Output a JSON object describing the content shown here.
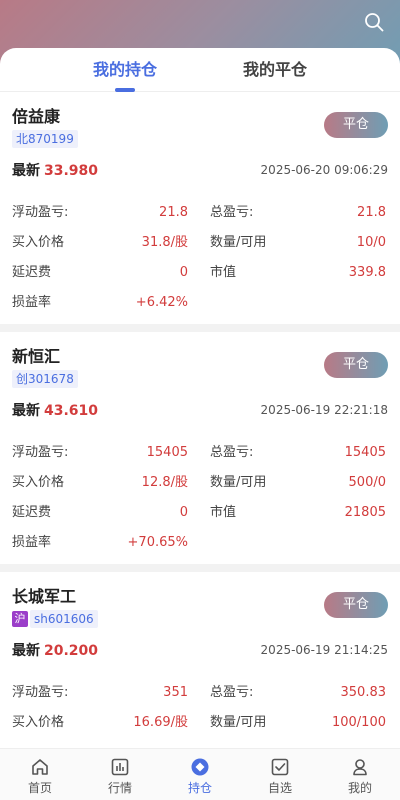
{
  "tabs": [
    "我的持仓",
    "我的平仓"
  ],
  "close_label": "平仓",
  "labels": {
    "latest": "最新",
    "float_pl": "浮动盈亏:",
    "total_pl": "总盈亏:",
    "buy_price": "买入价格",
    "qty": "数量/可用",
    "delay_fee": "延迟费",
    "market_value": "市值",
    "pl_rate": "损益率"
  },
  "positions": [
    {
      "name": "倍益康",
      "market": "北",
      "code": "870199",
      "latest": "33.980",
      "time": "2025-06-20 09:06:29",
      "float_pl": "21.8",
      "total_pl": "21.8",
      "buy_price": "31.8/股",
      "qty": "10/0",
      "delay_fee": "0",
      "market_value": "339.8",
      "pl_rate": "+6.42%"
    },
    {
      "name": "新恒汇",
      "market": "创",
      "code": "301678",
      "latest": "43.610",
      "time": "2025-06-19 22:21:18",
      "float_pl": "15405",
      "total_pl": "15405",
      "buy_price": "12.8/股",
      "qty": "500/0",
      "delay_fee": "0",
      "market_value": "21805",
      "pl_rate": "+70.65%"
    },
    {
      "name": "长城军工",
      "market": "沪",
      "code": "sh601606",
      "latest": "20.200",
      "time": "2025-06-19 21:14:25",
      "float_pl": "351",
      "total_pl": "350.83",
      "buy_price": "16.69/股",
      "qty": "100/100"
    }
  ],
  "tabbar": [
    {
      "label": "首页",
      "icon": "home-icon"
    },
    {
      "label": "行情",
      "icon": "chart-icon"
    },
    {
      "label": "持仓",
      "icon": "position-icon"
    },
    {
      "label": "自选",
      "icon": "checklist-icon"
    },
    {
      "label": "我的",
      "icon": "profile-icon"
    }
  ],
  "colors": {
    "accent": "#4a6ee0",
    "up": "#d23c3c",
    "gradient_start": "#b87a86",
    "gradient_end": "#6f9eb4"
  }
}
